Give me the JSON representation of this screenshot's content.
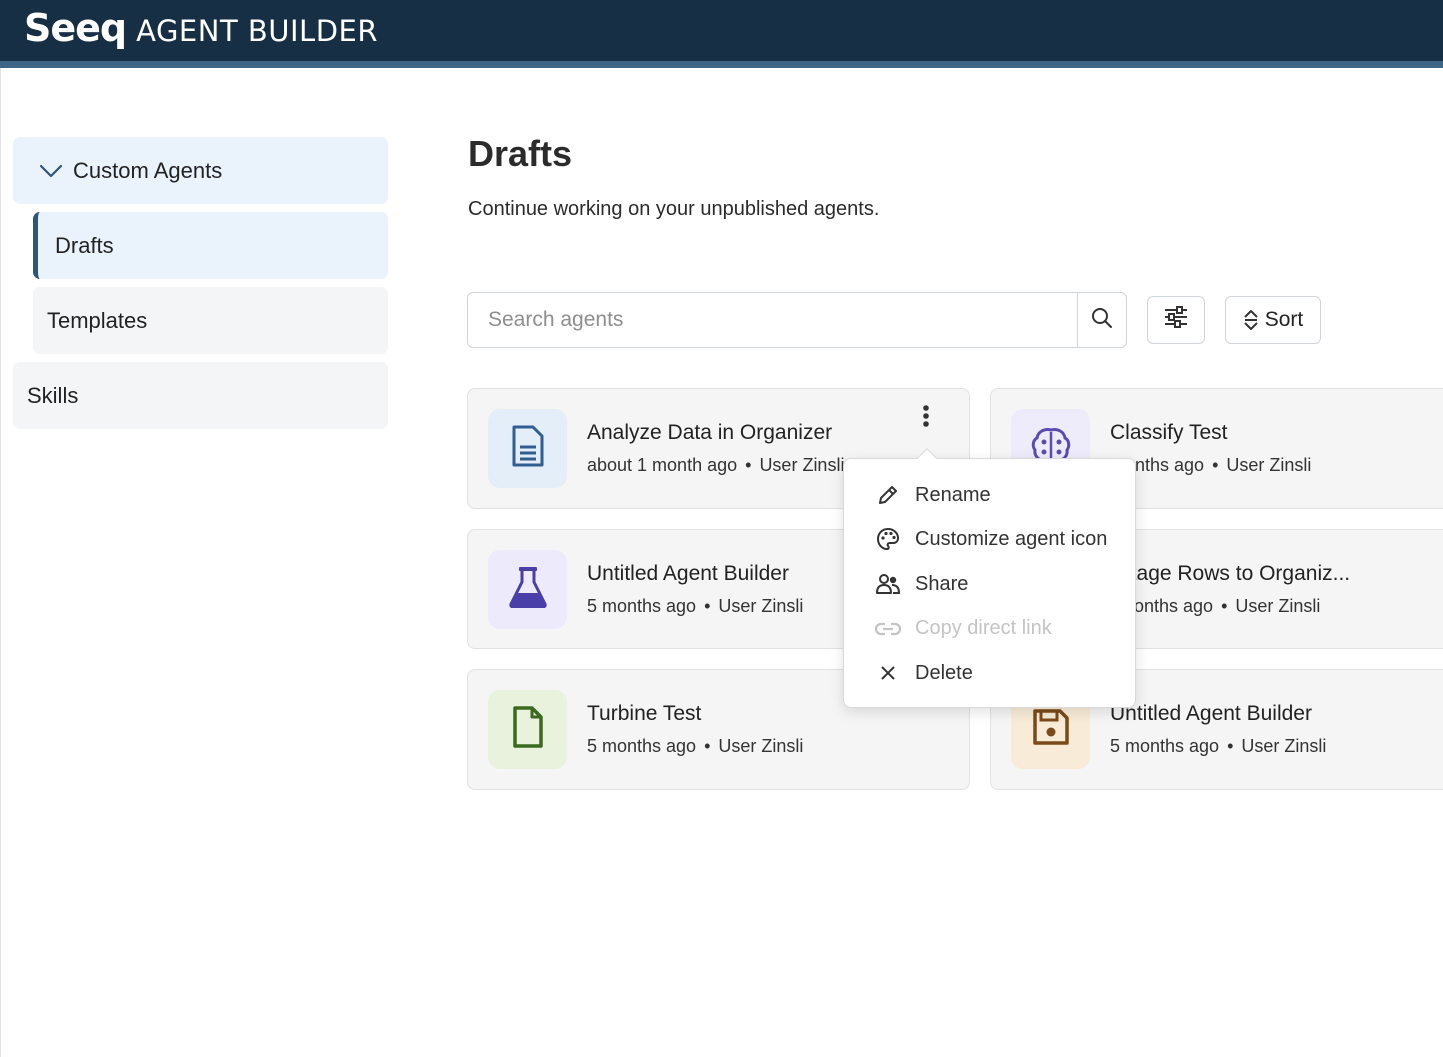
{
  "header": {
    "logo": "Seeq",
    "title": "AGENT BUILDER"
  },
  "sidebar": {
    "items": [
      {
        "label": "Custom Agents"
      },
      {
        "label": "Drafts"
      },
      {
        "label": "Templates"
      },
      {
        "label": "Skills"
      }
    ]
  },
  "main": {
    "title": "Drafts",
    "subtitle": "Continue working on your unpublished agents.",
    "search": {
      "placeholder": "Search agents",
      "value": ""
    },
    "sort_label": "Sort"
  },
  "cards": [
    {
      "title": "Analyze Data in Organizer",
      "time": "about 1 month ago",
      "user": "User Zinsli",
      "icon": "document-icon",
      "tile_color": "#e3eef9",
      "icon_color": "#2f5e93"
    },
    {
      "title": "Classify Test",
      "time": "months ago",
      "user": "User Zinsli",
      "icon": "brain-icon",
      "tile_color": "#eeebfb",
      "icon_color": "#5b4bb0"
    },
    {
      "title": "Untitled Agent Builder",
      "time": "5 months ago",
      "user": "User Zinsli",
      "icon": "flask-icon",
      "tile_color": "#edeafb",
      "icon_color": "#4a3ea8"
    },
    {
      "title": "ntage Rows to Organiz...",
      "time": "months ago",
      "user": "User Zinsli",
      "icon": "unknown-icon",
      "tile_color": "#f5f5f5",
      "icon_color": "#333333"
    },
    {
      "title": "Turbine Test",
      "time": "5 months ago",
      "user": "User Zinsli",
      "icon": "file-icon",
      "tile_color": "#e9f2dd",
      "icon_color": "#3a6a1e"
    },
    {
      "title": "Untitled Agent Builder",
      "time": "5 months ago",
      "user": "User Zinsli",
      "icon": "floppy-disk-icon",
      "tile_color": "#f8ecd8",
      "icon_color": "#7a4a18"
    }
  ],
  "menu": {
    "items": [
      {
        "label": "Rename",
        "icon": "pencil-icon",
        "disabled": false
      },
      {
        "label": "Customize agent icon",
        "icon": "palette-icon",
        "disabled": false
      },
      {
        "label": "Share",
        "icon": "users-icon",
        "disabled": false
      },
      {
        "label": "Copy direct link",
        "icon": "link-icon",
        "disabled": true
      },
      {
        "label": "Delete",
        "icon": "close-icon",
        "disabled": false
      }
    ]
  },
  "separator": "•"
}
